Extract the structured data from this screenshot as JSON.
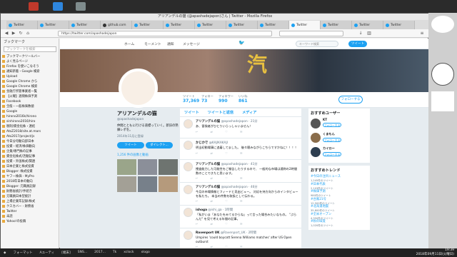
{
  "window": {
    "title": "アリアンデルの猫 (@apashadejapon)さん | Twitter - Mozilla Firefox"
  },
  "tabs": [
    "Twitter",
    "Twitter",
    "Twitter",
    "github.com",
    "Twitter",
    "Twitter",
    "Twitter",
    "Twitter",
    "Twitter",
    "Twitter",
    "Twitter",
    "Twitter",
    "Twitter"
  ],
  "nav": {
    "url": "https://twitter.com/apashadejapon"
  },
  "sidebar": {
    "header": "ブックマーク",
    "search_placeholder": "ブックマークを検索",
    "items": [
      "ブックマークツールバー",
      "よく見るページ",
      "Firefox を使いこなそう",
      "通知新着・Google 検索",
      "Upload",
      "Google Chrome から",
      "Google Chrome 検索",
      "金融庁所管事業者一覧",
      "【火曜】週間株価予測",
      "Facebook",
      "全般・一般株価数値",
      "Google",
      "hirono2016k/hirono",
      "sinhirono2016/hiro",
      "税制/資金化株・連結",
      "AtoZ2018/site.at.mars",
      "Ato2017/project/js",
      "今日分母動向部日本",
      "投資・経済/株価動向",
      "企業/専門株の記事",
      "資金化株式/活動記事",
      "投資・外国株式/関連",
      "日本企業と株式投資",
      "Blogger: 株式投資",
      "ヤフー株価 - MyPro",
      "2018年日本の動向",
      "Blogger: 元職員記録",
      "財務省統計/手続き",
      "元職員日本型統計",
      "上場企業年記録/株式",
      "クスカバー - 財務省",
      "Twitter",
      "未読",
      "Yahoo!の投稿"
    ]
  },
  "twitter": {
    "nav": {
      "home": "ホーム",
      "moments": "モーメント",
      "notifications": "通知",
      "messages": "メッセージ",
      "search_placeholder": "キーワード検索",
      "tweet_button": "ツイート"
    },
    "banner_text": "汽",
    "stats": [
      {
        "label": "ツイート",
        "value": "37,369"
      },
      {
        "label": "フォロー",
        "value": "73"
      },
      {
        "label": "フォロワー",
        "value": "990"
      },
      {
        "label": "いいね",
        "value": "861"
      }
    ],
    "follow_button": "フォローする",
    "profile": {
      "name": "アリアンデルの猫",
      "handle": "@apashadejapon",
      "bio": "仲間とともに行ける道標っていく。新旧の熟練レポを。",
      "joined": "2014年11月に登録",
      "tweet_btn": "ツイート",
      "dm_btn": "ダイレクト...",
      "media_link": "1,256 件の画像と動画"
    },
    "timeline_tabs": [
      "ツイート",
      "ツイートと返信",
      "メディア"
    ],
    "tweets": [
      {
        "name": "アリアンデルの猫",
        "handle": "@apashadejapon · 21分",
        "text": "あ、冒険者がひとりいらっしゃいません！"
      },
      {
        "name": "かじかで",
        "handle": "@KAJIKAKAJI",
        "text": "明当初動場事に追着してました。 後々聴みながらこちらですかねに！！！！"
      },
      {
        "name": "アリアンデルの猫",
        "handle": "@apashadejapon · 41分",
        "text": "捜査能力した可能性をご報告したりするので、 一般的な市場は通称の2時間数のことできたと思います。"
      },
      {
        "name": "アリアンデルの猫",
        "handle": "@apashadejapon · 46分",
        "text": "今月の市場情報とフィードと見出ビュー。 対応を持方向からのインタビューを私たち。 本当の件数を取扱として伝わる。"
      },
      {
        "name": "ishoga",
        "handle": "@ishi_ga · 1時間",
        "text": "「私がいま「あなたをみてるからね」って言った場合みたいなもの。 \"ぷらんだ\" を見て考える年間の記事。"
      },
      {
        "name": "Ravenport UK",
        "handle": "@Ravenport_UK · 2時間",
        "text": "Umpires 'could boycott Serena Williams matches' after US Open outburst"
      }
    ],
    "who_to_follow": {
      "title": "おすすめユーザー",
      "follow_label": "フォローする",
      "users": [
        "KT",
        "くまもん",
        "カイロー"
      ]
    },
    "trends": {
      "title": "おすすめトレンド",
      "items": [
        {
          "tag": "#今日の注目ニュース",
          "meta": "1,245件のツイート"
        },
        {
          "tag": "#日本代表",
          "meta": "2,103件のツイート"
        },
        {
          "tag": "#株価予測",
          "meta": "980件のツイート"
        },
        {
          "tag": "#台風21号",
          "meta": "12,500件のツイート"
        },
        {
          "tag": "#北海道地震",
          "meta": "35,800件のツイート"
        },
        {
          "tag": "#全米オープン",
          "meta": "4,350件のツイート"
        },
        {
          "tag": "#秋の味覚",
          "meta": "1,020件のツイート"
        }
      ]
    }
  },
  "taskbar": {
    "items": [
      "フォーマット",
      "Aユーティ",
      "[端末]",
      "SNS...",
      "2017...",
      "Tk",
      "xclock",
      "xlogo"
    ],
    "clock_time": "19:39",
    "clock_date": "2018年09月11日(火曜日)"
  },
  "colors": {
    "twitter_blue": "#1da1f2",
    "page_bg": "#e6ecf0"
  }
}
